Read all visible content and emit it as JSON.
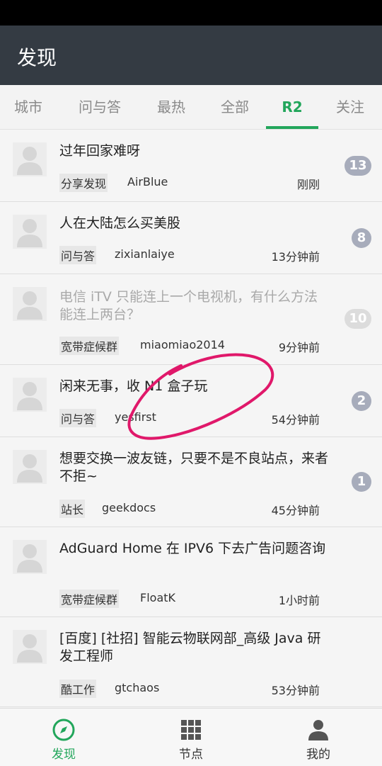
{
  "header": {
    "title": "发现"
  },
  "tabs": [
    {
      "label": "城市"
    },
    {
      "label": "问与答"
    },
    {
      "label": "最热"
    },
    {
      "label": "全部"
    },
    {
      "label": "R2",
      "active": true
    },
    {
      "label": "关注"
    }
  ],
  "topics": [
    {
      "title": "过年回家难呀",
      "node": "分享发现",
      "author": "AirBlue",
      "time": "刚刚",
      "replies": "13",
      "read": false
    },
    {
      "title": "人在大陆怎么买美股",
      "node": "问与答",
      "author": "zixianlaiye",
      "time": "13分钟前",
      "replies": "8",
      "read": false
    },
    {
      "title": "电信 iTV 只能连上一个电视机，有什么方法能连上两台？",
      "node": "宽带症候群",
      "author": "miaomiao2014",
      "time": "9分钟前",
      "replies": "10",
      "read": true
    },
    {
      "title": "闲来无事，收 N1 盒子玩",
      "node": "问与答",
      "author": "yesfirst",
      "time": "54分钟前",
      "replies": "2",
      "read": false
    },
    {
      "title": "想要交换一波友链，只要不是不良站点，来者不拒~",
      "node": "站长",
      "author": "geekdocs",
      "time": "45分钟前",
      "replies": "1",
      "read": false
    },
    {
      "title": "AdGuard Home 在 IPV6 下去广告问题咨询",
      "node": "宽带症候群",
      "author": "FloatK",
      "time": "1小时前",
      "replies": "",
      "read": false
    },
    {
      "title": "[百度] [社招] 智能云物联网部_高级 Java 研发工程师",
      "node": "酷工作",
      "author": "gtchaos",
      "time": "53分钟前",
      "replies": "",
      "read": false
    }
  ],
  "bottom_nav": [
    {
      "label": "发现",
      "icon": "compass-icon",
      "active": true
    },
    {
      "label": "节点",
      "icon": "grid-icon",
      "active": false
    },
    {
      "label": "我的",
      "icon": "person-icon",
      "active": false
    }
  ],
  "colors": {
    "accent": "#22a65b",
    "appbar": "#343b43",
    "badge": "#a7acbb",
    "annotation": "#e0186a"
  }
}
